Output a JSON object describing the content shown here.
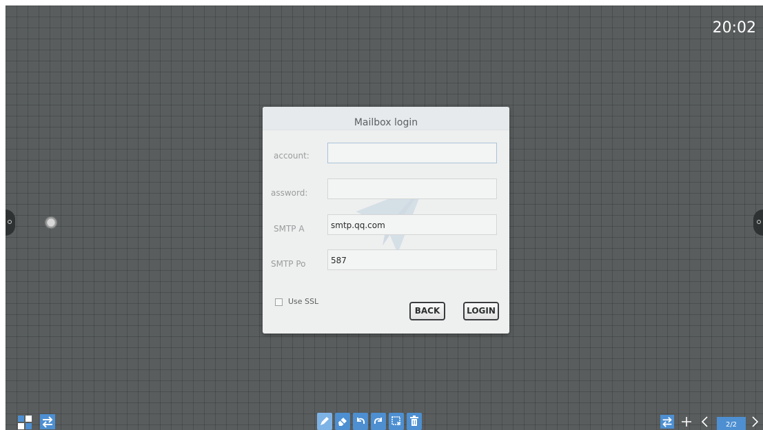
{
  "status": {
    "clock": "20:02"
  },
  "dialog": {
    "title": "Mailbox login",
    "fields": [
      {
        "label": "account:",
        "value": "",
        "placeholder": ""
      },
      {
        "label": "assword:",
        "value": "",
        "placeholder": ""
      },
      {
        "label": "SMTP A",
        "value": "smtp.qq.com",
        "placeholder": ""
      },
      {
        "label": "SMTP Po",
        "value": "587",
        "placeholder": ""
      }
    ],
    "use_ssl_label": "Use SSL",
    "use_ssl_checked": false,
    "back_label": "BACK",
    "login_label": "LOGIN"
  },
  "toolbar": {
    "left_icons": [
      "apps-grid-icon",
      "switch-icon"
    ],
    "center_tools": [
      "pen-icon",
      "eraser-icon",
      "undo-icon",
      "redo-icon",
      "select-icon",
      "trash-icon"
    ],
    "right_icons": [
      "switch-icon",
      "add-page-icon",
      "prev-page-icon",
      "next-page-icon"
    ],
    "page_indicator": "2/2"
  },
  "colors": {
    "board": "#595d5d",
    "accent": "#4d8fd1",
    "dialog_bg": "#eeefef"
  }
}
